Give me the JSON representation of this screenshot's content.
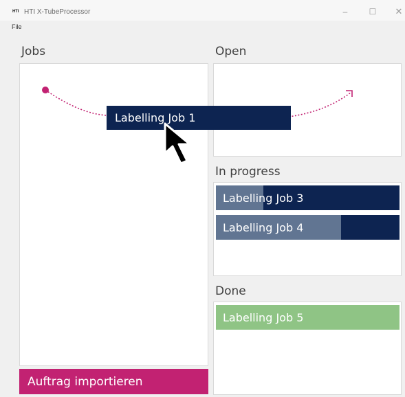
{
  "window": {
    "logo": "HTI",
    "title": "HTI X-TubeProcessor",
    "minimize_glyph": "–",
    "maximize_glyph": "☐",
    "close_glyph": "✕"
  },
  "menu": {
    "file": "File"
  },
  "sections": {
    "jobs": "Jobs",
    "open": "Open",
    "in_progress": "In progress",
    "done": "Done"
  },
  "dragging_job": {
    "label": "Labelling Job 1"
  },
  "in_progress_jobs": [
    {
      "label": "Labelling Job 3",
      "progress": 0.26
    },
    {
      "label": "Labelling Job 4",
      "progress": 0.68
    }
  ],
  "done_jobs": [
    {
      "label": "Labelling Job 5"
    }
  ],
  "import_button": "Auftrag importieren",
  "colors": {
    "job_dark": "#0d2451",
    "job_progress_fill": "#617592",
    "job_done": "#8fc485",
    "accent_magenta": "#c22272"
  },
  "icons": {
    "drag_arc": "dotted-arc-arrow-icon",
    "cursor": "mouse-pointer-icon"
  }
}
